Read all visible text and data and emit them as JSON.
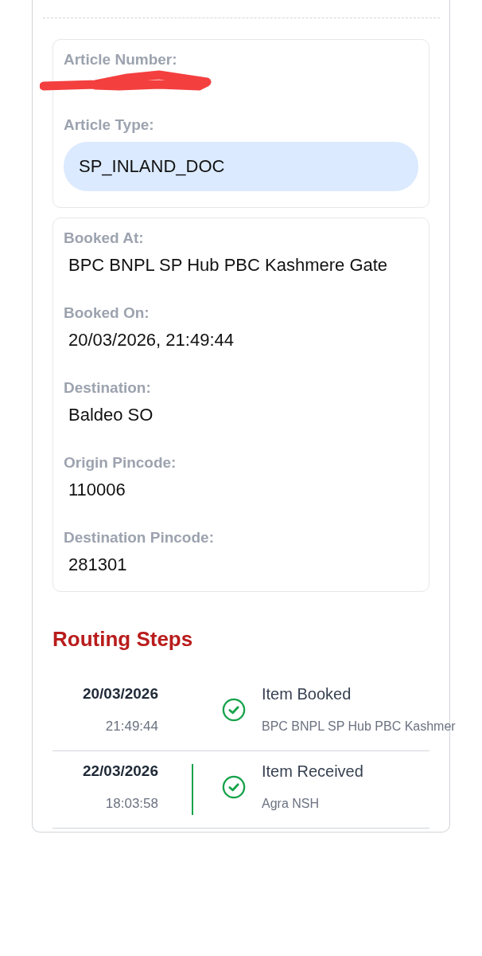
{
  "article": {
    "number_label": "Article Number:",
    "number_redacted": true,
    "type_label": "Article Type:",
    "type": "SP_INLAND_DOC"
  },
  "details": [
    {
      "label": "Booked At:",
      "value": "BPC BNPL SP Hub PBC Kashmere Gate"
    },
    {
      "label": "Booked On:",
      "value": "20/03/2026, 21:49:44"
    },
    {
      "label": "Destination:",
      "value": "Baldeo SO"
    },
    {
      "label": "Origin Pincode:",
      "value": "110006"
    },
    {
      "label": "Destination Pincode:",
      "value": "281301"
    }
  ],
  "routing": {
    "title": "Routing Steps",
    "steps": [
      {
        "date": "20/03/2026",
        "time": "21:49:44",
        "event": "Item Booked",
        "location": "BPC BNPL SP Hub PBC Kashmer",
        "done": true,
        "connector": false
      },
      {
        "date": "22/03/2026",
        "time": "18:03:58",
        "event": "Item Received",
        "location": "Agra NSH",
        "done": true,
        "connector": true
      }
    ]
  }
}
